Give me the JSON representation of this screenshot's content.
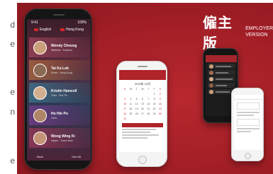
{
  "article_fragments": [
    "d",
    "e",
    "e",
    "n",
    "e"
  ],
  "brand": {
    "title_cn": "僱主版",
    "title_en_line1": "EMPLOYER",
    "title_en_line2": "VERSION"
  },
  "phone1": {
    "status_left": "9:41",
    "status_right": "100%",
    "languages": [
      {
        "label": "English",
        "flag_color": "#cc2b2b"
      },
      {
        "label": "Hong Kong",
        "flag_color": "#d62828"
      }
    ],
    "candidates": [
      {
        "name": "Wendy Cheung",
        "sub": "Waitress · Kowloon",
        "avatar": "#c9a07a",
        "tint": "#a3475e"
      },
      {
        "name": "Tai Ka Lok",
        "sub": "Driver · Hong Kong",
        "avatar": "#8a6a54",
        "tint": "#b56f3e"
      },
      {
        "name": "Kristin Hamcell",
        "sub": "Tutor · Sha Tin",
        "avatar": "#d2ae8e",
        "tint": "#3e7a92"
      },
      {
        "name": "Ho Hin Po",
        "sub": "Clerk",
        "avatar": "#b08668",
        "tint": "#7a3f94"
      },
      {
        "name": "Wong Wing Ki",
        "sub": "Helper · Tsuen Wan",
        "avatar": "#c49478",
        "tint": "#a33a5a"
      }
    ],
    "bottom_left": "Back",
    "bottom_right": "Hire All"
  },
  "phone2": {
    "month": "2016年 10月",
    "days": [
      "S",
      "M",
      "T",
      "W",
      "T",
      "F",
      "S",
      "",
      "",
      "",
      "",
      "",
      "1",
      "2",
      "3",
      "4",
      "5",
      "6",
      "7",
      "8",
      "9",
      "10",
      "11",
      "12",
      "13",
      "14",
      "15",
      "16",
      "17",
      "18",
      "19",
      "20",
      "21",
      "22",
      "23",
      "24",
      "25",
      "26",
      "27",
      "28",
      "29",
      "30",
      "31"
    ]
  }
}
